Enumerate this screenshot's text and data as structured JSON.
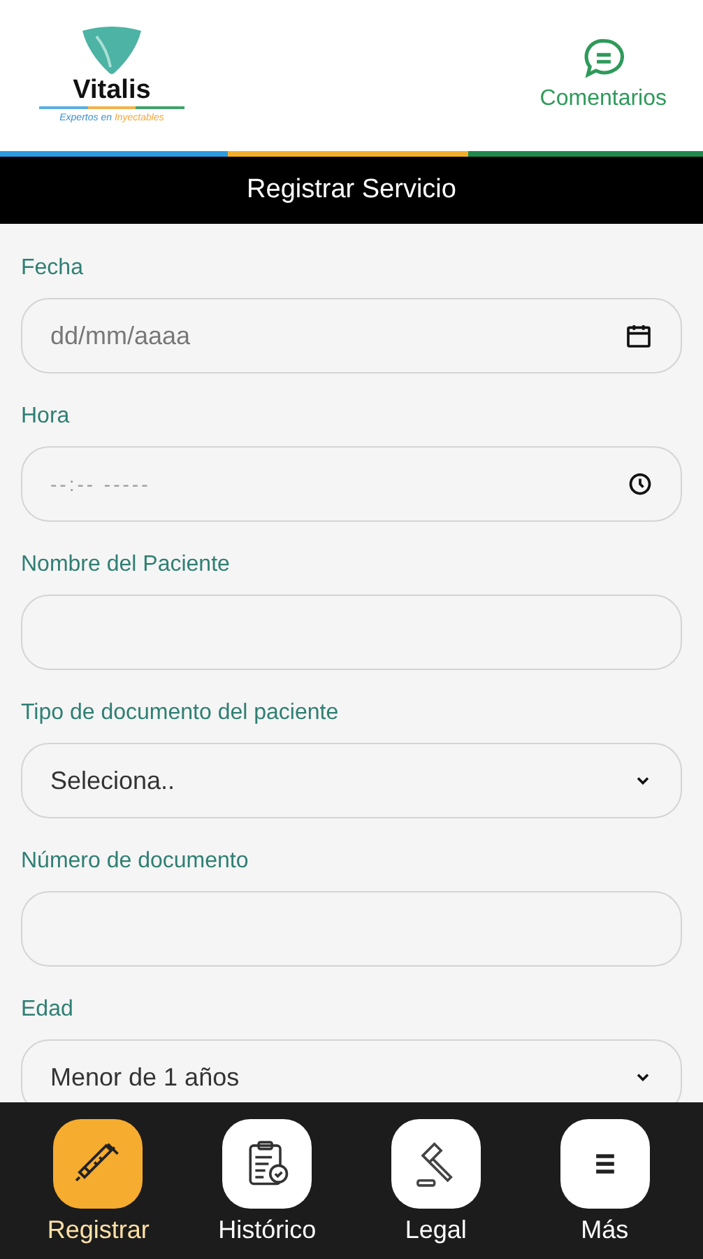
{
  "header": {
    "logo": {
      "name": "Vitalis",
      "tagline_part_1": "Expertos en",
      "tagline_part_2": "Inyectables"
    },
    "comments_button": "Comentarios"
  },
  "title_bar": "Registrar Servicio",
  "form": {
    "fields": [
      {
        "kind": "date",
        "label": "Fecha",
        "placeholder": "dd/mm/aaaa"
      },
      {
        "kind": "time",
        "label": "Hora",
        "placeholder": "--:-- -----"
      },
      {
        "kind": "text",
        "label": "Nombre del Paciente"
      },
      {
        "kind": "select",
        "label": "Tipo de documento del paciente",
        "value": "Seleciona.."
      },
      {
        "kind": "text",
        "label": "Número de documento"
      },
      {
        "kind": "select",
        "label": "Edad",
        "value": "Menor de 1 años"
      }
    ]
  },
  "bottom_nav": [
    {
      "label": "Registrar",
      "selected": true
    },
    {
      "label": "Histórico",
      "selected": false
    },
    {
      "label": "Legal",
      "selected": false
    },
    {
      "label": "Más",
      "selected": false
    }
  ]
}
